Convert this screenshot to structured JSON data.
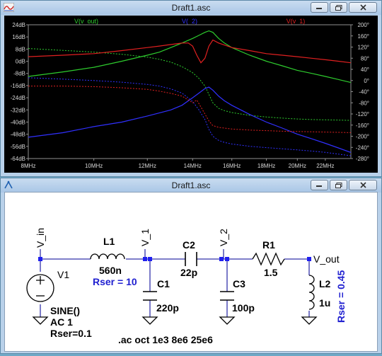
{
  "plot_window": {
    "title": "Draft1.asc"
  },
  "schematic_window": {
    "title": "Draft1.asc"
  },
  "chart_data": {
    "type": "line",
    "x_ticks": [
      "8MHz",
      "10MHz",
      "12MHz",
      "14MHz",
      "16MHz",
      "18MHz",
      "20MHz",
      "22MHz"
    ],
    "left_ticks": [
      "24dB",
      "16dB",
      "8dB",
      "0dB",
      "-8dB",
      "-16dB",
      "-24dB",
      "-32dB",
      "-40dB",
      "-48dB",
      "-56dB",
      "-64dB"
    ],
    "right_ticks": [
      "200°",
      "160°",
      "120°",
      "80°",
      "40°",
      "0°",
      "-40°",
      "-80°",
      "-120°",
      "-160°",
      "-200°",
      "-240°",
      "-280°"
    ],
    "xlim_mhz": [
      8,
      24
    ],
    "ylim_db": [
      -64,
      24
    ],
    "ylim_deg": [
      -280,
      200
    ],
    "grid": false,
    "series": [
      {
        "name": "V(v_out)",
        "color": "#2ecc2e",
        "freq_mhz": [
          8,
          9,
          10,
          11,
          12,
          12.5,
          13,
          13.5,
          14,
          14.3,
          14.6,
          14.8,
          15.0,
          15.3,
          15.6,
          16,
          17,
          18,
          19,
          20,
          21,
          22,
          23,
          24
        ],
        "mag_db": [
          -10,
          -7,
          -4,
          0,
          4,
          6,
          9,
          12,
          15,
          17,
          19,
          20,
          19,
          15,
          12,
          9,
          4,
          0,
          -3,
          -6,
          -8,
          -10,
          -12,
          -14
        ],
        "phase_deg": [
          115,
          108,
          102,
          94,
          84,
          76,
          66,
          50,
          28,
          8,
          -20,
          -50,
          -80,
          -100,
          -108,
          -115,
          -125,
          -131,
          -135,
          -138,
          -140,
          -141,
          -142,
          -143
        ]
      },
      {
        "name": "V(_2)",
        "color": "#3030ff",
        "freq_mhz": [
          8,
          9,
          10,
          11,
          12,
          12.5,
          13,
          13.5,
          14,
          14.3,
          14.6,
          14.8,
          15.0,
          15.3,
          15.6,
          16,
          17,
          18,
          19,
          20,
          21,
          22,
          23,
          24
        ],
        "mag_db": [
          -50,
          -47,
          -43,
          -40,
          -36,
          -34,
          -32,
          -29,
          -24,
          -21,
          -18,
          -17,
          -19,
          -23,
          -26,
          -29,
          -35,
          -40,
          -44,
          -48,
          -51,
          -54,
          -57,
          -60
        ],
        "phase_deg": [
          10,
          5,
          0,
          -6,
          -14,
          -20,
          -30,
          -45,
          -75,
          -105,
          -140,
          -175,
          -200,
          -215,
          -222,
          -228,
          -236,
          -241,
          -245,
          -249,
          -253,
          -258,
          -264,
          -270
        ]
      },
      {
        "name": "V(v_1)",
        "color": "#e02020",
        "freq_mhz": [
          8,
          9,
          10,
          11,
          12,
          12.5,
          13,
          13.5,
          13.8,
          14.0,
          14.2,
          14.4,
          14.6,
          14.8,
          15.0,
          15.3,
          16,
          17,
          18,
          19,
          20,
          21,
          22,
          23,
          24
        ],
        "mag_db": [
          3,
          4,
          5,
          7,
          9,
          10,
          11,
          12,
          12,
          10,
          4,
          -1,
          2,
          10,
          14,
          12,
          9,
          7,
          5,
          4,
          3,
          2,
          1,
          0,
          -1
        ],
        "phase_deg": [
          -20,
          -20,
          -22,
          -26,
          -32,
          -38,
          -46,
          -56,
          -70,
          -80,
          -70,
          -95,
          -120,
          -145,
          -162,
          -168,
          -174,
          -178,
          -180,
          -182,
          -183,
          -184,
          -185,
          -186,
          -187
        ]
      }
    ]
  },
  "schematic": {
    "labels": {
      "v_in": "V_in",
      "v_1": "V_1",
      "v_2": "V_2",
      "v_out": "V_out",
      "v1_name": "V1",
      "v1_sine": "SINE()",
      "v1_ac": "AC 1",
      "v1_rser": "Rser=0.1",
      "l1_name": "L1",
      "l1_val": "560n",
      "l1_rser": "Rser = 10",
      "c1_name": "C1",
      "c1_val": "220p",
      "c2_name": "C2",
      "c2_val": "22p",
      "c3_name": "C3",
      "c3_val": "100p",
      "r1_name": "R1",
      "r1_val": "1.5",
      "l2_name": "L2",
      "l2_val": "1u",
      "l2_rser": "Rser = 0.45",
      "directive": ".ac oct 1e3 8e6 25e6"
    }
  }
}
